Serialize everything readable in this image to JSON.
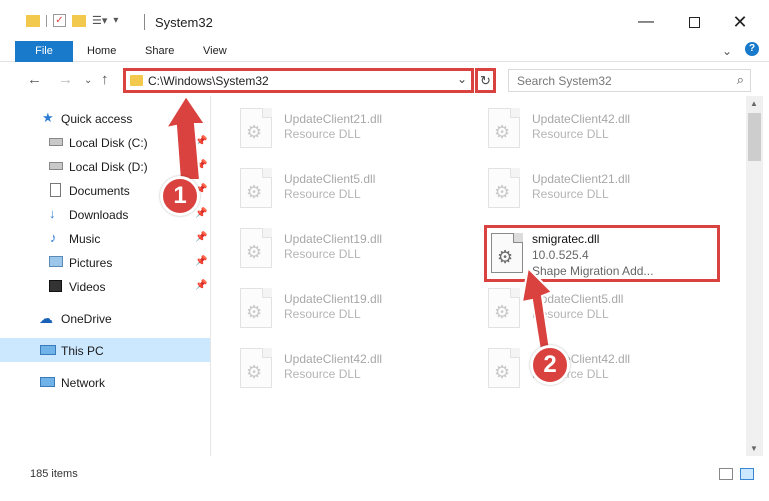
{
  "window": {
    "title": "System32",
    "minimize_icon": "minimize-icon",
    "maximize_icon": "maximize-icon",
    "close_icon": "close-icon"
  },
  "ribbon": {
    "tabs": [
      "File",
      "Home",
      "Share",
      "View"
    ],
    "accent": "#1979ca"
  },
  "address": {
    "path": "C:\\Windows\\System32",
    "search_placeholder": "Search System32"
  },
  "sidebar": {
    "items": [
      {
        "label": "Quick access",
        "icon": "star-icon"
      },
      {
        "label": "Local Disk (C:)",
        "icon": "drive-icon",
        "pinned": true
      },
      {
        "label": "Local Disk (D:)",
        "icon": "drive-icon",
        "pinned": true
      },
      {
        "label": "Documents",
        "icon": "documents-icon",
        "pinned": true
      },
      {
        "label": "Downloads",
        "icon": "download-icon",
        "pinned": true
      },
      {
        "label": "Music",
        "icon": "music-icon",
        "pinned": true
      },
      {
        "label": "Pictures",
        "icon": "pictures-icon",
        "pinned": true
      },
      {
        "label": "Videos",
        "icon": "videos-icon",
        "pinned": true
      },
      {
        "label": "OneDrive",
        "icon": "cloud-icon"
      },
      {
        "label": "This PC",
        "icon": "computer-icon",
        "selected": true
      },
      {
        "label": "Network",
        "icon": "network-icon"
      }
    ]
  },
  "files": [
    {
      "name": "UpdateClient21.dll",
      "type": "Resource DLL"
    },
    {
      "name": "UpdateClient42.dll",
      "type": "Resource DLL"
    },
    {
      "name": "UpdateClient5.dll",
      "type": "Resource DLL"
    },
    {
      "name": "UpdateClient21.dll",
      "type": "Resource DLL"
    },
    {
      "name": "UpdateClient19.dll",
      "type": "Resource DLL"
    },
    {
      "name": "UpdateClient19.dll",
      "type": "Resource DLL"
    },
    {
      "name": "UpdateClient5.dll",
      "type": "Resource DLL"
    },
    {
      "name": "UpdateClient42.dll",
      "type": "Resource DLL"
    },
    {
      "name": "UpdateClient42.dll",
      "type": "Resource DLL"
    }
  ],
  "highlighted_file": {
    "name": "smigratec.dll",
    "version": "10.0.525.4",
    "description": "Shape Migration Add..."
  },
  "status": {
    "item_count": "185 items"
  },
  "annotations": {
    "step1": "1",
    "step2": "2",
    "color": "#d9423e"
  }
}
